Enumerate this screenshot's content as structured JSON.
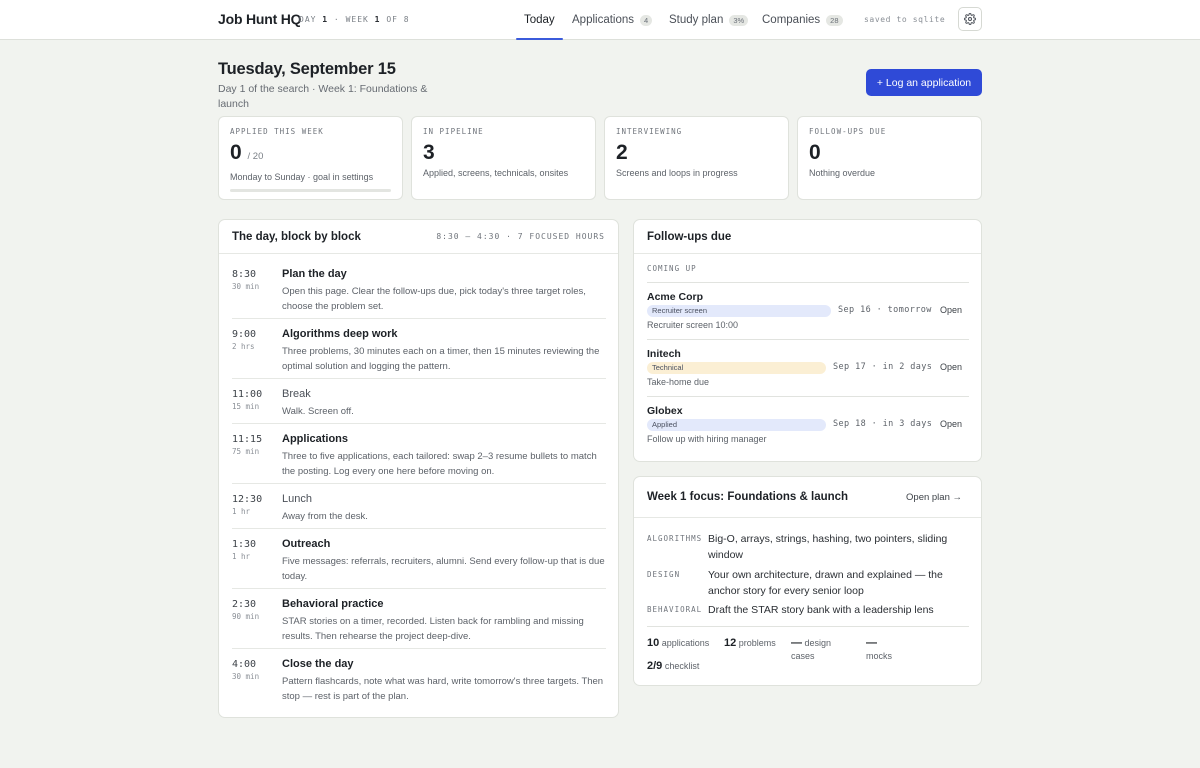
{
  "app": {
    "title": "Job Hunt HQ",
    "day_prefix": "DAY",
    "day": "1",
    "week_prefix": "WEEK",
    "week": "1",
    "week_of": "OF 8",
    "saved": "saved to sqlite",
    "accent": "#2f4ad7"
  },
  "nav": {
    "today": "Today",
    "applications": "Applications",
    "applications_count": "4",
    "study": "Study plan",
    "study_pct": "3%",
    "companies": "Companies",
    "companies_count": "28",
    "settings_icon": "gear-icon"
  },
  "header": {
    "title": "Tuesday, September 15",
    "subtitle": "Day 1 of the search · Week 1: Foundations & launch",
    "cta": "+ Log an application"
  },
  "stats": [
    {
      "label": "APPLIED THIS WEEK",
      "value": "0",
      "suffix": "/ 20",
      "note": "Monday to Sunday · goal in settings",
      "progress": 0
    },
    {
      "label": "IN PIPELINE",
      "value": "3",
      "note": "Applied, screens, technicals, onsites"
    },
    {
      "label": "INTERVIEWING",
      "value": "2",
      "note": "Screens and loops in progress"
    },
    {
      "label": "FOLLOW-UPS DUE",
      "value": "0",
      "note": "Nothing overdue"
    }
  ],
  "schedule": {
    "title": "The day, block by block",
    "meta": "8:30 – 4:30 · 7 FOCUSED HOURS",
    "blocks": [
      {
        "time": "8:30",
        "dur": "30 min",
        "title": "Plan the day",
        "desc": "Open this page. Clear the follow-ups due, pick today's three target roles, choose the problem set."
      },
      {
        "time": "9:00",
        "dur": "2 hrs",
        "title": "Algorithms deep work",
        "desc": "Three problems, 30 minutes each on a timer, then 15 minutes reviewing the optimal solution and logging the pattern."
      },
      {
        "time": "11:00",
        "dur": "15 min",
        "title": "Break",
        "desc": "Walk. Screen off."
      },
      {
        "time": "11:15",
        "dur": "75 min",
        "title": "Applications",
        "desc": "Three to five applications, each tailored: swap 2–3 resume bullets to match the posting. Log every one here before moving on."
      },
      {
        "time": "12:30",
        "dur": "1 hr",
        "title": "Lunch",
        "desc": "Away from the desk."
      },
      {
        "time": "1:30",
        "dur": "1 hr",
        "title": "Outreach",
        "desc": "Five messages: referrals, recruiters, alumni. Send every follow-up that is due today."
      },
      {
        "time": "2:30",
        "dur": "90 min",
        "title": "Behavioral practice",
        "desc": "STAR stories on a timer, recorded. Listen back for rambling and missing results. Then rehearse the project deep-dive."
      },
      {
        "time": "4:00",
        "dur": "30 min",
        "title": "Close the day",
        "desc": "Pattern flashcards, note what was hard, write tomorrow's three targets. Then stop — rest is part of the plan."
      }
    ]
  },
  "followups": {
    "title": "Follow-ups due",
    "kicker": "COMING UP",
    "items": [
      {
        "company": "Acme Corp",
        "tag": "Recruiter screen",
        "tag_color": "#e3e9fb",
        "date": "Sep 16 · tomorrow",
        "note": "Recruiter screen 10:00",
        "action": "Open"
      },
      {
        "company": "Initech",
        "tag": "Technical",
        "tag_color": "#fbefd4",
        "date": "Sep 17 · in 2 days",
        "note": "Take-home due",
        "action": "Open"
      },
      {
        "company": "Globex",
        "tag": "Applied",
        "tag_color": "#e3e9fb",
        "date": "Sep 18 · in 3 days",
        "note": "Follow up with hiring manager",
        "action": "Open"
      }
    ]
  },
  "focus": {
    "title": "Week 1 focus: Foundations & launch",
    "open_plan": "Open plan →",
    "rows": [
      {
        "key": "ALGORITHMS",
        "value": "Big-O, arrays, strings, hashing, two pointers, sliding window"
      },
      {
        "key": "DESIGN",
        "value": "Your own architecture, drawn and explained — the anchor story for every senior loop"
      },
      {
        "key": "BEHAVIORAL",
        "value": "Draft the STAR story bank with a leadership lens"
      }
    ],
    "kpis": {
      "apps_value": "10",
      "apps_label": "applications",
      "problems_value": "12",
      "problems_label": "problems",
      "design_value": "—",
      "design_label": "design cases",
      "mocks_value": "—",
      "mocks_label": "mocks",
      "checklist_value": "2/9",
      "checklist_label": "checklist"
    }
  }
}
